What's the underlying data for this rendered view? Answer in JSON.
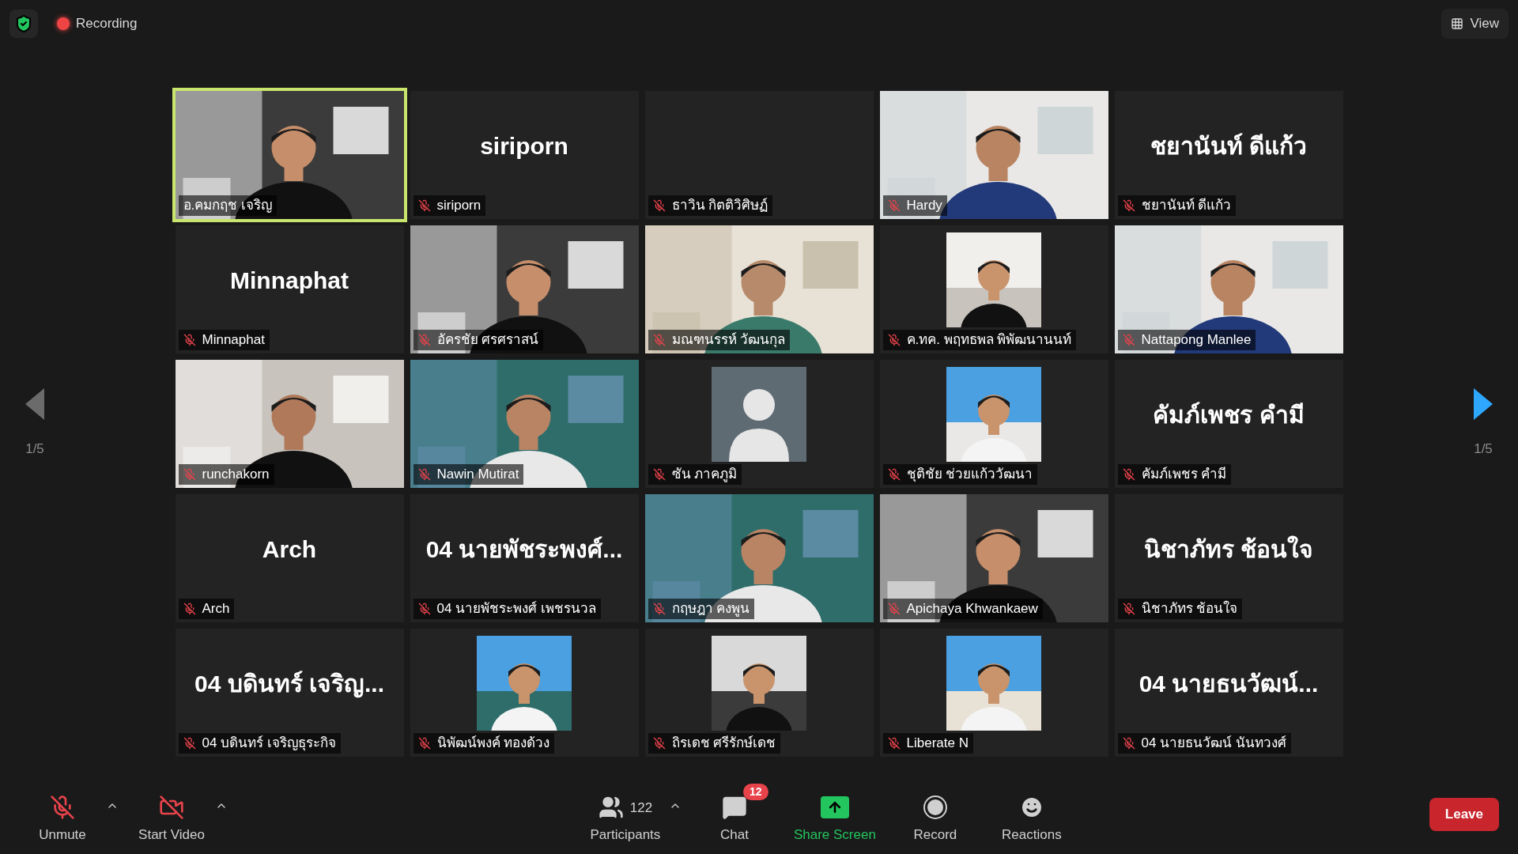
{
  "top_bar": {
    "recording_label": "Recording",
    "view_label": "View"
  },
  "pager": {
    "previous": {
      "label": "1/5",
      "disabled": true
    },
    "next": {
      "label": "1/5",
      "disabled": false
    }
  },
  "tiles": [
    {
      "kind": "video",
      "name": "อ.คมกฤช เจริญ",
      "muted": false,
      "active": true
    },
    {
      "kind": "name",
      "display": "siriporn",
      "name": "siriporn",
      "muted": true,
      "active": false
    },
    {
      "kind": "blank",
      "name": "ธาวิน กิตติวิศิษฏ์",
      "muted": true,
      "active": false
    },
    {
      "kind": "video",
      "name": "Hardy",
      "muted": true,
      "active": false
    },
    {
      "kind": "name",
      "display": "ชยานันท์ ดีแก้ว",
      "name": "ชยานันท์ ดีแก้ว",
      "muted": true,
      "active": false
    },
    {
      "kind": "name",
      "display": "Minnaphat",
      "name": "Minnaphat",
      "muted": true,
      "active": false
    },
    {
      "kind": "video",
      "name": "อัครชัย ศรศราสน์",
      "muted": true,
      "active": false
    },
    {
      "kind": "video",
      "name": "มณฑนรรห์ วัฒนกุล",
      "muted": true,
      "active": false
    },
    {
      "name": "ค.ทค. พฤทธพล พิพัฒนานนท์",
      "muted": true,
      "active": false
    },
    {
      "kind": "video",
      "name": "Nattapong Manlee",
      "muted": true,
      "active": false
    },
    {
      "kind": "video",
      "name": "runchakorn",
      "muted": true,
      "active": false
    },
    {
      "kind": "video",
      "name": "Nawin Mutirat",
      "muted": true,
      "active": false
    },
    {
      "kind": "avatar",
      "name": "ซัน ภาคภูมิ",
      "muted": true,
      "active": false
    },
    {
      "name": "ชุติชัย ช่วยแก้ววัฒนา",
      "muted": true,
      "active": false
    },
    {
      "kind": "name",
      "display": "คัมภ์เพชร คำมี",
      "name": "คัมภ์เพชร คำมี",
      "muted": true,
      "active": false
    },
    {
      "kind": "name",
      "display": "Arch",
      "name": "Arch",
      "muted": true,
      "active": false
    },
    {
      "kind": "name",
      "display": "04 นายพัชระพงศ์...",
      "name": "04 นายพัชระพงศ์ เพชรนวล",
      "muted": true,
      "active": false
    },
    {
      "kind": "video",
      "name": "กฤษฎา คงพูน",
      "muted": true,
      "active": false
    },
    {
      "kind": "video",
      "name": "Apichaya Khwankaew",
      "muted": true,
      "active": false
    },
    {
      "kind": "name",
      "display": "นิชาภัทร ช้อนใจ",
      "name": "นิชาภัทร ช้อนใจ",
      "muted": true,
      "active": false
    },
    {
      "kind": "name",
      "display": "04 บดินทร์ เจริญ...",
      "name": "04 บดินทร์ เจริญธุระกิจ",
      "muted": true,
      "active": false
    },
    {
      "name": "นิพัฒน์พงค์ ทองด้วง",
      "muted": true,
      "active": false
    },
    {
      "name": "ถิรเดช ศรีรักษ์เดช",
      "muted": true,
      "active": false
    },
    {
      "name": "Liberate N",
      "muted": true,
      "active": false
    },
    {
      "kind": "name",
      "display": "04 นายธนวัฒน์...",
      "name": "04 นายธนวัฒน์ นันทวงศ์",
      "muted": true,
      "active": false
    }
  ],
  "toolbar": [
    {
      "kind": "mic",
      "label": "Unmute",
      "has_menu": true
    },
    {
      "kind": "video",
      "label": "Start Video",
      "has_menu": true
    },
    {
      "kind": "participants",
      "label": "Participants",
      "count": "122",
      "has_menu": true
    },
    {
      "kind": "chat",
      "label": "Chat",
      "badge": "12",
      "has_menu": false
    },
    {
      "kind": "share",
      "label": "Share Screen",
      "has_menu": false
    },
    {
      "kind": "record",
      "label": "Record",
      "has_menu": false
    },
    {
      "kind": "reactions",
      "label": "Reactions",
      "has_menu": false
    }
  ],
  "leave_label": "Leave"
}
